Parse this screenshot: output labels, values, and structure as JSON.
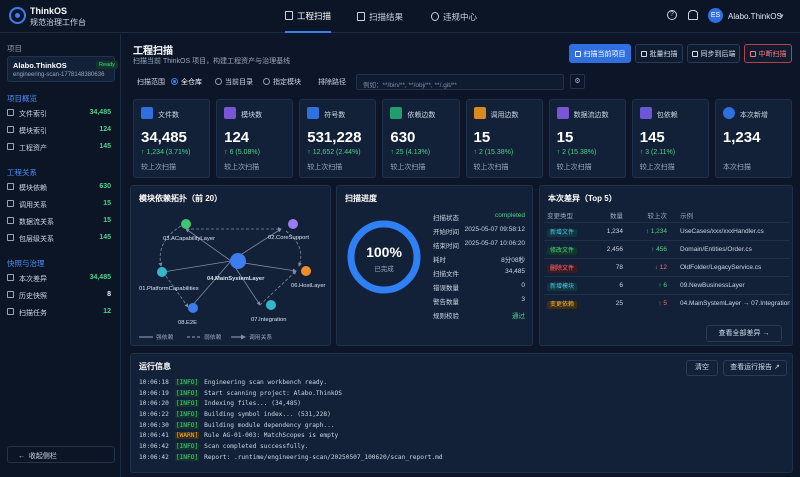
{
  "app": {
    "name": "ThinkOS",
    "subtitle": "规范治理工作台"
  },
  "nav": [
    {
      "label": "工程扫描"
    },
    {
      "label": "扫描结果"
    },
    {
      "label": "违规中心"
    }
  ],
  "user": {
    "initials": "ES",
    "name": "Alabo.ThinkOS"
  },
  "sidebar": {
    "project_label": "项目",
    "project": {
      "name": "Alabo.ThinkOS",
      "status": "Ready",
      "id": "engineering-scan-1778148380636"
    },
    "sections": [
      {
        "title": "项目概览",
        "items": [
          {
            "label": "文件索引",
            "value": "34,485"
          },
          {
            "label": "模块索引",
            "value": "124"
          },
          {
            "label": "工程资产",
            "value": "145"
          }
        ]
      },
      {
        "title": "工程关系",
        "items": [
          {
            "label": "模块依赖",
            "value": "630"
          },
          {
            "label": "调用关系",
            "value": "15"
          },
          {
            "label": "数据流关系",
            "value": "15"
          },
          {
            "label": "包层级关系",
            "value": "145"
          }
        ]
      },
      {
        "title": "快照与治理",
        "items": [
          {
            "label": "本次差异",
            "value": "34,485"
          },
          {
            "label": "历史快照",
            "value": "8"
          },
          {
            "label": "扫描任务",
            "value": "12"
          }
        ]
      }
    ],
    "collapse": "收起侧栏"
  },
  "page": {
    "title": "工程扫描",
    "subtitle": "扫描当前 ThinkOS 项目，构建工程资产与治理基线"
  },
  "actions": {
    "scan": "扫描当前项目",
    "batch": "批量扫描",
    "sync": "同步到后端",
    "abort": "中断扫描"
  },
  "filter": {
    "range_label": "扫描范围",
    "options": [
      "全仓库",
      "当前目录",
      "指定模块"
    ],
    "exclude_label": "排除路径",
    "exclude_placeholder": "例如：**/bin/**, **/obj/**, **/.git/**"
  },
  "stats": [
    {
      "label": "文件数",
      "value": "34,485",
      "delta": "↑ 1,234 (3.71%)",
      "compare": "较上次扫描",
      "color": "#2f6fe0"
    },
    {
      "label": "模块数",
      "value": "124",
      "delta": "↑ 6 (5.08%)",
      "compare": "较上次扫描",
      "color": "#7a55d6"
    },
    {
      "label": "符号数",
      "value": "531,228",
      "delta": "↑ 12,652 (2.44%)",
      "compare": "较上次扫描",
      "color": "#2f6fe0"
    },
    {
      "label": "依赖边数",
      "value": "630",
      "delta": "↑ 25 (4.13%)",
      "compare": "较上次扫描",
      "color": "#1f9e6e"
    },
    {
      "label": "调用边数",
      "value": "15",
      "delta": "↑ 2 (15.38%)",
      "compare": "较上次扫描",
      "color": "#d98a1f"
    },
    {
      "label": "数据流边数",
      "value": "15",
      "delta": "↑ 2 (15.38%)",
      "compare": "较上次扫描",
      "color": "#7a55d6"
    },
    {
      "label": "包依赖",
      "value": "145",
      "delta": "↑ 3 (2.11%)",
      "compare": "较上次扫描",
      "color": "#6a58d8"
    },
    {
      "label": "本次新增",
      "value": "1,234",
      "delta": "",
      "compare": "本次扫描",
      "color": "#2f6fe0"
    }
  ],
  "topology": {
    "title": "模块依赖拓扑（前 20）",
    "nodes": [
      "03.ACapabilityLayer",
      "02.CoreSupport",
      "04.MainSystemLayer",
      "01.PlatformCapabilities",
      "06.HostLayer",
      "08.E2E",
      "07.Integration"
    ],
    "legend": [
      "强依赖",
      "弱依赖",
      "调用关系"
    ]
  },
  "progress": {
    "title": "扫描进度",
    "percent": "100%",
    "status_text": "已完成",
    "percent_value": 1.0,
    "fields": [
      {
        "label": "扫描状态",
        "value": "completed"
      },
      {
        "label": "开始时间",
        "value": "2025-05-07 09:58:12"
      },
      {
        "label": "结束时间",
        "value": "2025-05-07 10:06:20"
      },
      {
        "label": "耗时",
        "value": "8分08秒"
      },
      {
        "label": "扫描文件",
        "value": "34,485"
      },
      {
        "label": "错误数量",
        "value": "0"
      },
      {
        "label": "警告数量",
        "value": "3"
      },
      {
        "label": "规则校验",
        "value": "通过"
      }
    ]
  },
  "diff": {
    "title": "本次差异（Top 5）",
    "headers": [
      "变更类型",
      "数量",
      "较上次",
      "示例"
    ],
    "rows": [
      {
        "type": "新增文件",
        "count": "1,234",
        "delta": "↑ 1,234",
        "example": "UseCases/xxx/xxxHandler.cs",
        "color": "#4ec3e0",
        "bg": "#103642",
        "dcolor": "#4ed18a"
      },
      {
        "type": "修改文件",
        "count": "2,456",
        "delta": "↑ 456",
        "example": "Domain/Entities/Order.cs",
        "color": "#4ed18a",
        "bg": "#10362a",
        "dcolor": "#4ed18a"
      },
      {
        "type": "删除文件",
        "count": "78",
        "delta": "↓ 12",
        "example": "OldFolder/LegacyService.cs",
        "color": "#ff6b74",
        "bg": "#3d1a22",
        "dcolor": "#ff6b74"
      },
      {
        "type": "新增模块",
        "count": "6",
        "delta": "↑ 6",
        "example": "09.NewBusinessLayer",
        "color": "#4ec3e0",
        "bg": "#103642",
        "dcolor": "#4ed18a"
      },
      {
        "type": "变更依赖",
        "count": "25",
        "delta": "↑ 5",
        "example": "04.MainSystemLayer → 07.Integration",
        "color": "#f5b342",
        "bg": "#3d2e10",
        "dcolor": "#ff6b74"
      }
    ],
    "see_all": "查看全部差异 →"
  },
  "log": {
    "title": "运行信息",
    "clear": "清空",
    "report": "查看运行报告",
    "lines": [
      {
        "time": "10:06:18",
        "level": "[INFO]",
        "msg": "Engineering scan workbench ready."
      },
      {
        "time": "10:06:19",
        "level": "[INFO]",
        "msg": "Start scanning project: Alabo.ThinkOS"
      },
      {
        "time": "10:06:20",
        "level": "[INFO]",
        "msg": "Indexing files... (34,485)"
      },
      {
        "time": "10:06:22",
        "level": "[INFO]",
        "msg": "Building symbol index... (531,228)"
      },
      {
        "time": "10:06:30",
        "level": "[INFO]",
        "msg": "Building module dependency graph..."
      },
      {
        "time": "10:06:41",
        "level": "[WARN]",
        "msg": "Rule AG-01-003: MatchScopes is empty"
      },
      {
        "time": "10:06:42",
        "level": "[INFO]",
        "msg": "Scan completed successfully."
      },
      {
        "time": "10:06:42",
        "level": "[INFO]",
        "msg": "Report: .runtime/engineering-scan/20250507_100620/scan_report.md"
      }
    ]
  }
}
